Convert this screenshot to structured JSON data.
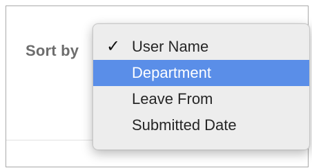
{
  "sort": {
    "label": "Sort by",
    "selected_value": "User Name",
    "options": [
      {
        "label": "User Name",
        "checked": true,
        "highlighted": false
      },
      {
        "label": "Department",
        "checked": false,
        "highlighted": true
      },
      {
        "label": "Leave From",
        "checked": false,
        "highlighted": false
      },
      {
        "label": "Submitted Date",
        "checked": false,
        "highlighted": false
      }
    ]
  },
  "icons": {
    "check": "✓"
  },
  "colors": {
    "highlight": "#5a8ee8",
    "label_text": "#6d6d6d",
    "menu_bg": "#ececec"
  }
}
